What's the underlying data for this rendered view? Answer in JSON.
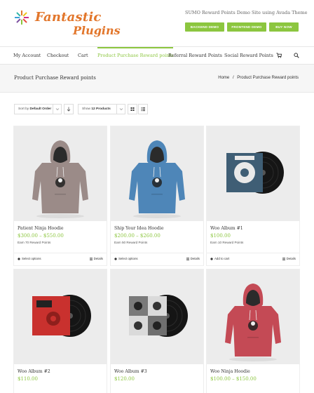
{
  "brand": {
    "line1": "Fantastic",
    "line2": "Plugins",
    "tagline": "SUMO Reward Points Demo Site using Avada Theme",
    "accent": "#8cc63f",
    "logo_color": "#e2762b"
  },
  "header_buttons": [
    "BACKEND DEMO",
    "FRONTEND DEMO",
    "BUY NOW"
  ],
  "nav": {
    "items": [
      "My Account",
      "Checkout",
      "Cart",
      "Product Purchase Reward points",
      "Referral Reward Points",
      "Social Reward Points"
    ],
    "active_index": 3,
    "icons": [
      "cart-icon",
      "search-icon"
    ]
  },
  "page": {
    "title": "Product Purchase Reward points",
    "breadcrumb": [
      "Home",
      "/",
      "Product Purchase Reward points"
    ]
  },
  "toolbar": {
    "sort_prefix": "Sort by",
    "sort_value": "Default Order",
    "show_prefix": "Show",
    "show_value": "12 Products"
  },
  "products": [
    {
      "name": "Patient Ninja Hoodie",
      "price": "$300.00 – $550.00",
      "points": "Earn 70 Reward Points",
      "action": "Select options",
      "details": "Details",
      "image": "hoodie",
      "color": "#9b8b88"
    },
    {
      "name": "Ship Your Idea Hoodie",
      "price": "$200.00 – $260.00",
      "points": "Earn 50 Reward Points",
      "action": "Select options",
      "details": "Details",
      "image": "hoodie",
      "color": "#4e86b8"
    },
    {
      "name": "Woo Album #1",
      "price": "$100.00",
      "points": "Earn 10 Reward Points",
      "action": "Add to cart",
      "details": "Details",
      "image": "album",
      "color": "#3f5e75"
    },
    {
      "name": "Woo Album #2",
      "price": "$110.00",
      "points": "",
      "action": "",
      "details": "",
      "image": "album-red",
      "color": "#c9312e"
    },
    {
      "name": "Woo Album #3",
      "price": "$120.00",
      "points": "",
      "action": "",
      "details": "",
      "image": "album-gray",
      "color": "#8a8a8a"
    },
    {
      "name": "Woo Ninja Hoodie",
      "price": "$100.00 – $150.00",
      "points": "",
      "action": "",
      "details": "",
      "image": "hoodie",
      "color": "#c44a55"
    }
  ]
}
